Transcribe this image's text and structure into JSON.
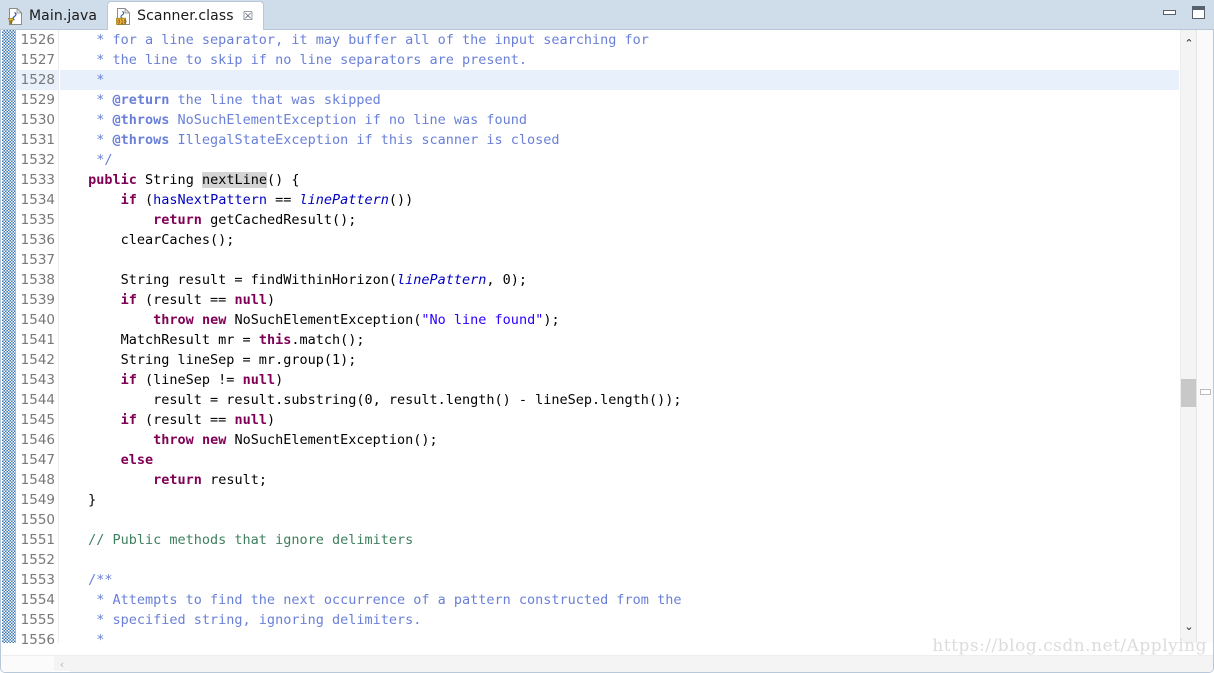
{
  "window": {
    "minimize_label": "Minimize",
    "maximize_label": "Maximize"
  },
  "tabs": [
    {
      "label": "Main.java",
      "icon": "java-file-icon",
      "active": false,
      "closable": false
    },
    {
      "label": "Scanner.class",
      "icon": "class-file-icon",
      "active": true,
      "closable": true,
      "close_glyph": "☒"
    }
  ],
  "editor": {
    "first_line_number": 1526,
    "current_line_number": 1528,
    "highlighted_token": "nextLine",
    "lines": [
      {
        "n": 1526,
        "tokens": [
          {
            "t": "  * for a line separator, it may buffer all of the input searching for",
            "c": "tok-jdoc"
          }
        ]
      },
      {
        "n": 1527,
        "tokens": [
          {
            "t": "  * the line to skip if no line separators are present.",
            "c": "tok-jdoc"
          }
        ]
      },
      {
        "n": 1528,
        "current": true,
        "tokens": [
          {
            "t": "  *",
            "c": "tok-jdoc"
          }
        ]
      },
      {
        "n": 1529,
        "tokens": [
          {
            "t": "  * ",
            "c": "tok-jdoc"
          },
          {
            "t": "@return",
            "c": "tok-jtag"
          },
          {
            "t": " the line that was skipped",
            "c": "tok-jdoc"
          }
        ]
      },
      {
        "n": 1530,
        "tokens": [
          {
            "t": "  * ",
            "c": "tok-jdoc"
          },
          {
            "t": "@throws",
            "c": "tok-jtag"
          },
          {
            "t": " NoSuchElementException if no line was found",
            "c": "tok-jdoc"
          }
        ]
      },
      {
        "n": 1531,
        "tokens": [
          {
            "t": "  * ",
            "c": "tok-jdoc"
          },
          {
            "t": "@throws",
            "c": "tok-jtag"
          },
          {
            "t": " IllegalStateException if this scanner is closed",
            "c": "tok-jdoc"
          }
        ]
      },
      {
        "n": 1532,
        "tokens": [
          {
            "t": "  */",
            "c": "tok-jdoc"
          }
        ]
      },
      {
        "n": 1533,
        "tokens": [
          {
            "t": " ",
            "c": "tok-plain"
          },
          {
            "t": "public",
            "c": "tok-key"
          },
          {
            "t": " String ",
            "c": "tok-plain"
          },
          {
            "t": "nextLine",
            "c": "tok-plain tok-sel"
          },
          {
            "t": "() {",
            "c": "tok-plain"
          }
        ]
      },
      {
        "n": 1534,
        "tokens": [
          {
            "t": "     ",
            "c": "tok-plain"
          },
          {
            "t": "if",
            "c": "tok-key"
          },
          {
            "t": " (",
            "c": "tok-plain"
          },
          {
            "t": "hasNextPattern",
            "c": "tok-field"
          },
          {
            "t": " == ",
            "c": "tok-plain"
          },
          {
            "t": "linePattern",
            "c": "tok-ital"
          },
          {
            "t": "())",
            "c": "tok-plain"
          }
        ]
      },
      {
        "n": 1535,
        "tokens": [
          {
            "t": "         ",
            "c": "tok-plain"
          },
          {
            "t": "return",
            "c": "tok-key"
          },
          {
            "t": " getCachedResult();",
            "c": "tok-plain"
          }
        ]
      },
      {
        "n": 1536,
        "tokens": [
          {
            "t": "     clearCaches();",
            "c": "tok-plain"
          }
        ]
      },
      {
        "n": 1537,
        "tokens": [
          {
            "t": "",
            "c": "tok-plain"
          }
        ]
      },
      {
        "n": 1538,
        "tokens": [
          {
            "t": "     String result = findWithinHorizon(",
            "c": "tok-plain"
          },
          {
            "t": "linePattern",
            "c": "tok-ital"
          },
          {
            "t": ", 0);",
            "c": "tok-plain"
          }
        ]
      },
      {
        "n": 1539,
        "tokens": [
          {
            "t": "     ",
            "c": "tok-plain"
          },
          {
            "t": "if",
            "c": "tok-key"
          },
          {
            "t": " (result == ",
            "c": "tok-plain"
          },
          {
            "t": "null",
            "c": "tok-key"
          },
          {
            "t": ")",
            "c": "tok-plain"
          }
        ]
      },
      {
        "n": 1540,
        "tokens": [
          {
            "t": "         ",
            "c": "tok-plain"
          },
          {
            "t": "throw",
            "c": "tok-key"
          },
          {
            "t": " ",
            "c": "tok-plain"
          },
          {
            "t": "new",
            "c": "tok-key"
          },
          {
            "t": " NoSuchElementException(",
            "c": "tok-plain"
          },
          {
            "t": "\"No line found\"",
            "c": "tok-str"
          },
          {
            "t": ");",
            "c": "tok-plain"
          }
        ]
      },
      {
        "n": 1541,
        "tokens": [
          {
            "t": "     MatchResult mr = ",
            "c": "tok-plain"
          },
          {
            "t": "this",
            "c": "tok-key"
          },
          {
            "t": ".match();",
            "c": "tok-plain"
          }
        ]
      },
      {
        "n": 1542,
        "tokens": [
          {
            "t": "     String lineSep = mr.group(1);",
            "c": "tok-plain"
          }
        ]
      },
      {
        "n": 1543,
        "tokens": [
          {
            "t": "     ",
            "c": "tok-plain"
          },
          {
            "t": "if",
            "c": "tok-key"
          },
          {
            "t": " (lineSep != ",
            "c": "tok-plain"
          },
          {
            "t": "null",
            "c": "tok-key"
          },
          {
            "t": ")",
            "c": "tok-plain"
          }
        ]
      },
      {
        "n": 1544,
        "tokens": [
          {
            "t": "         result = result.substring(0, result.length() - lineSep.length());",
            "c": "tok-plain"
          }
        ]
      },
      {
        "n": 1545,
        "tokens": [
          {
            "t": "     ",
            "c": "tok-plain"
          },
          {
            "t": "if",
            "c": "tok-key"
          },
          {
            "t": " (result == ",
            "c": "tok-plain"
          },
          {
            "t": "null",
            "c": "tok-key"
          },
          {
            "t": ")",
            "c": "tok-plain"
          }
        ]
      },
      {
        "n": 1546,
        "tokens": [
          {
            "t": "         ",
            "c": "tok-plain"
          },
          {
            "t": "throw",
            "c": "tok-key"
          },
          {
            "t": " ",
            "c": "tok-plain"
          },
          {
            "t": "new",
            "c": "tok-key"
          },
          {
            "t": " NoSuchElementException();",
            "c": "tok-plain"
          }
        ]
      },
      {
        "n": 1547,
        "tokens": [
          {
            "t": "     ",
            "c": "tok-plain"
          },
          {
            "t": "else",
            "c": "tok-key"
          }
        ]
      },
      {
        "n": 1548,
        "tokens": [
          {
            "t": "         ",
            "c": "tok-plain"
          },
          {
            "t": "return",
            "c": "tok-key"
          },
          {
            "t": " result;",
            "c": "tok-plain"
          }
        ]
      },
      {
        "n": 1549,
        "tokens": [
          {
            "t": " }",
            "c": "tok-plain"
          }
        ]
      },
      {
        "n": 1550,
        "tokens": [
          {
            "t": "",
            "c": "tok-plain"
          }
        ]
      },
      {
        "n": 1551,
        "tokens": [
          {
            "t": " // Public methods that ignore delimiters",
            "c": "tok-cmt"
          }
        ]
      },
      {
        "n": 1552,
        "tokens": [
          {
            "t": "",
            "c": "tok-plain"
          }
        ]
      },
      {
        "n": 1553,
        "tokens": [
          {
            "t": " /**",
            "c": "tok-jdoc"
          }
        ]
      },
      {
        "n": 1554,
        "tokens": [
          {
            "t": "  * Attempts to find the next occurrence of a pattern constructed from the",
            "c": "tok-jdoc"
          }
        ]
      },
      {
        "n": 1555,
        "tokens": [
          {
            "t": "  * specified string, ignoring delimiters.",
            "c": "tok-jdoc"
          }
        ]
      },
      {
        "n": 1556,
        "tokens": [
          {
            "t": "  *",
            "c": "tok-jdoc"
          }
        ]
      }
    ]
  },
  "scrollbars": {
    "vertical": {
      "up_glyph": "⌃",
      "down_glyph": "⌄"
    },
    "horizontal": {
      "left_glyph": "‹"
    }
  },
  "watermark": "https://blog.csdn.net/Applying",
  "colors": {
    "tabbar_bg": "#cfdcea",
    "active_tab_bg": "#ffffff",
    "current_line_bg": "#e8f0fb",
    "keyword": "#7f0055",
    "string": "#2a00ff",
    "line_comment": "#3f7f5f",
    "javadoc": "#6a80d8",
    "field": "#0000c0",
    "line_number": "#787878",
    "annotation_ruler": "#3c78b4"
  }
}
